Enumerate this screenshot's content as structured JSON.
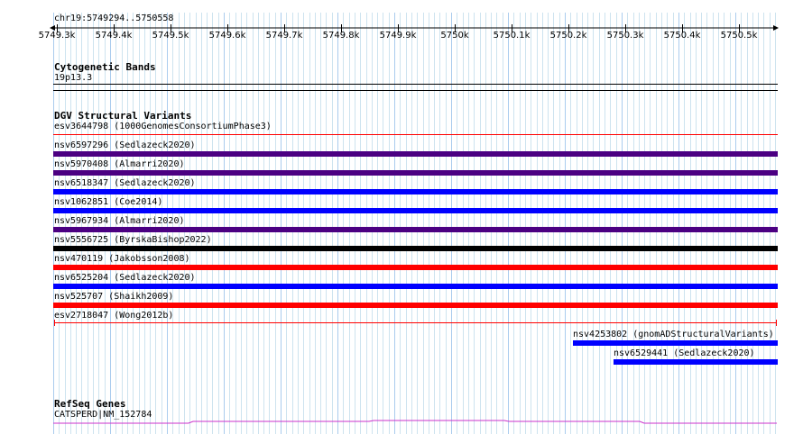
{
  "ruler": {
    "position": "chr19:5749294..5750558",
    "ticks": [
      "5749.3k",
      "5749.4k",
      "5749.5k",
      "5749.6k",
      "5749.7k",
      "5749.8k",
      "5749.9k",
      "5750k",
      "5750.1k",
      "5750.2k",
      "5750.3k",
      "5750.4k",
      "5750.5k"
    ]
  },
  "cytobands": {
    "title": "Cytogenetic Bands",
    "band": "19p13.3"
  },
  "dgv": {
    "title": "DGV Structural Variants",
    "variants": [
      {
        "label": "esv3644798 (1000GenomesConsortiumPhase3)",
        "color": "#ff0000",
        "style": "thin"
      },
      {
        "label": "nsv6597296 (Sedlazeck2020)",
        "color": "#4b0082",
        "style": "bar"
      },
      {
        "label": "nsv5970408 (Almarri2020)",
        "color": "#4b0082",
        "style": "bar"
      },
      {
        "label": "nsv6518347 (Sedlazeck2020)",
        "color": "#0000ff",
        "style": "bar"
      },
      {
        "label": "nsv1062851 (Coe2014)",
        "color": "#0000ff",
        "style": "bar"
      },
      {
        "label": "nsv5967934 (Almarri2020)",
        "color": "#4b0082",
        "style": "bar"
      },
      {
        "label": "nsv5556725 (ByrskaBishop2022)",
        "color": "#000000",
        "style": "bar"
      },
      {
        "label": "nsv470119 (Jakobsson2008)",
        "color": "#ff0000",
        "style": "bar"
      },
      {
        "label": "nsv6525204 (Sedlazeck2020)",
        "color": "#0000ff",
        "style": "bar"
      },
      {
        "label": "nsv525707 (Shaikh2009)",
        "color": "#ff0000",
        "style": "bar"
      },
      {
        "label": "esv2718047 (Wong2012b)",
        "color": "#ff0000",
        "style": "thin"
      },
      {
        "label": "nsv4253802 (gnomADStructuralVariants)",
        "color": "#0000ff",
        "style": "bar"
      },
      {
        "label": "nsv6529441 (Sedlazeck2020)",
        "color": "#0000ff",
        "style": "bar"
      }
    ]
  },
  "refseq": {
    "title": "RefSeq Genes",
    "gene": "CATSPERD|NM_152784",
    "color": "#cc33cc"
  }
}
